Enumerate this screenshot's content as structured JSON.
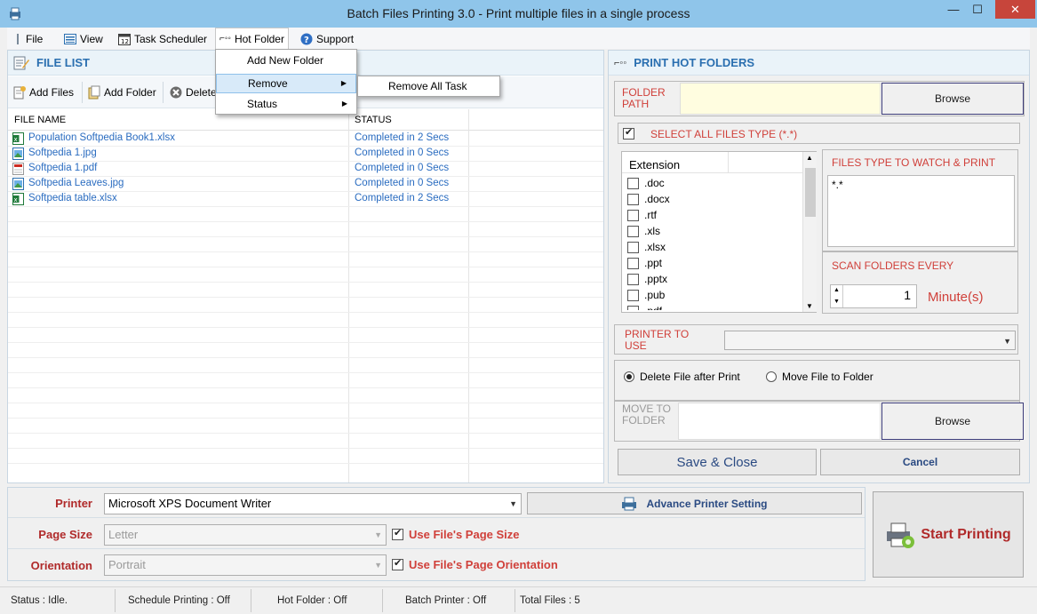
{
  "window": {
    "title": "Batch Files Printing 3.0 - Print multiple files in a single process",
    "minimize": "—",
    "maximize": "☐",
    "close": "✕"
  },
  "menu": {
    "items": [
      "File",
      "View",
      "Task Scheduler",
      "Hot Folder",
      "Support"
    ]
  },
  "hot_folder_menu": {
    "items": [
      {
        "label": "Add New Folder",
        "submenu": false
      },
      {
        "label": "Remove",
        "submenu": true
      },
      {
        "label": "Status",
        "submenu": true
      }
    ],
    "remove_submenu": [
      "Remove All Task"
    ]
  },
  "file_list": {
    "header": "FILE LIST",
    "toolbar": {
      "add_files": "Add Files",
      "add_folder": "Add Folder",
      "delete": "Delete"
    },
    "columns": [
      "FILE NAME",
      "STATUS"
    ],
    "rows": [
      {
        "name": "Population Softpedia Book1.xlsx",
        "status": "Completed in 2 Secs",
        "icon": "excel-icon"
      },
      {
        "name": "Softpedia 1.jpg",
        "status": "Completed in 0 Secs",
        "icon": "image-icon"
      },
      {
        "name": "Softpedia 1.pdf",
        "status": "Completed in 0 Secs",
        "icon": "pdf-icon"
      },
      {
        "name": "Softpedia Leaves.jpg",
        "status": "Completed in 0 Secs",
        "icon": "image-icon"
      },
      {
        "name": "Softpedia table.xlsx",
        "status": "Completed in 2 Secs",
        "icon": "excel-icon"
      }
    ]
  },
  "hot_folders": {
    "header": "PRINT HOT FOLDERS",
    "folder_path_label": "FOLDER PATH",
    "folder_path_value": "",
    "browse": "Browse",
    "select_all_label": "SELECT ALL FILES TYPE (*.*)",
    "select_all_checked": true,
    "extension_header": "Extension",
    "extensions": [
      ".doc",
      ".docx",
      ".rtf",
      ".xls",
      ".xlsx",
      ".ppt",
      ".pptx",
      ".pub",
      ".pdf"
    ],
    "files_type_label": "FILES TYPE TO WATCH & PRINT",
    "files_type_value": "*.*",
    "scan_label": "SCAN FOLDERS EVERY",
    "scan_value": "1",
    "scan_unit": "Minute(s)",
    "printer_label": "PRINTER TO USE",
    "printer_value": "",
    "after_print_options": [
      "Delete File after Print",
      "Move File to Folder"
    ],
    "after_print_selected": 0,
    "move_label": "MOVE TO FOLDER",
    "move_value": "",
    "move_browse": "Browse",
    "save_close": "Save & Close",
    "cancel": "Cancel"
  },
  "settings": {
    "printer_label": "Printer",
    "printer_value": "Microsoft XPS Document Writer",
    "advance_button": "Advance Printer Setting",
    "page_size_label": "Page Size",
    "page_size_value": "Letter",
    "use_page_size": "Use File's Page Size",
    "use_page_size_checked": true,
    "orientation_label": "Orientation",
    "orientation_value": "Portrait",
    "use_orientation": "Use File's Page Orientation",
    "use_orientation_checked": true,
    "start_button": "Start Printing"
  },
  "status_bar": {
    "status": "Status :  Idle.",
    "schedule": "Schedule Printing : Off",
    "hot_folder": "Hot Folder : Off",
    "batch_printer": "Batch Printer : Off",
    "total_files": "Total Files :  5"
  },
  "colors": {
    "titlebar": "#8fc5ea",
    "accent_blue": "#2a6fb0",
    "label_red": "#d0403a",
    "file_link_blue": "#2a6cc0"
  }
}
